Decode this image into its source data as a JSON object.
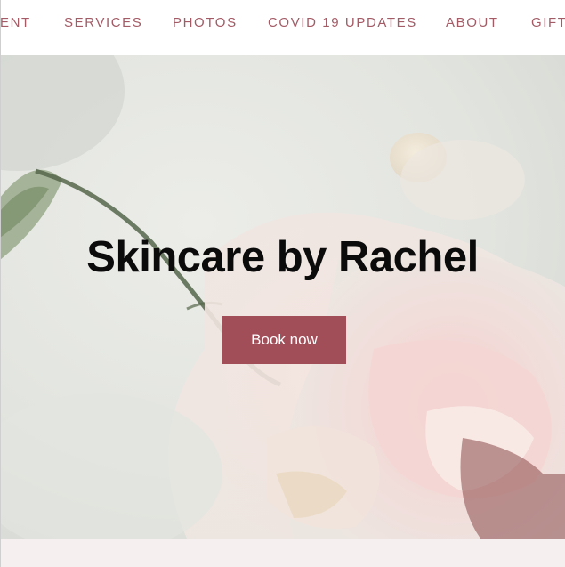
{
  "nav": {
    "items": [
      {
        "label": "ENT"
      },
      {
        "label": "SERVICES"
      },
      {
        "label": "PHOTOS"
      },
      {
        "label": "COVID 19 UPDATES"
      },
      {
        "label": "ABOUT"
      },
      {
        "label": "GIFT"
      }
    ]
  },
  "hero": {
    "title": "Skincare by Rachel",
    "book_label": "Book now"
  },
  "colors": {
    "nav_text": "#a35b66",
    "button_bg": "#a24e59",
    "button_text": "#ffffff",
    "title_text": "#0b0b0b",
    "bottom_band": "#f6efef"
  }
}
